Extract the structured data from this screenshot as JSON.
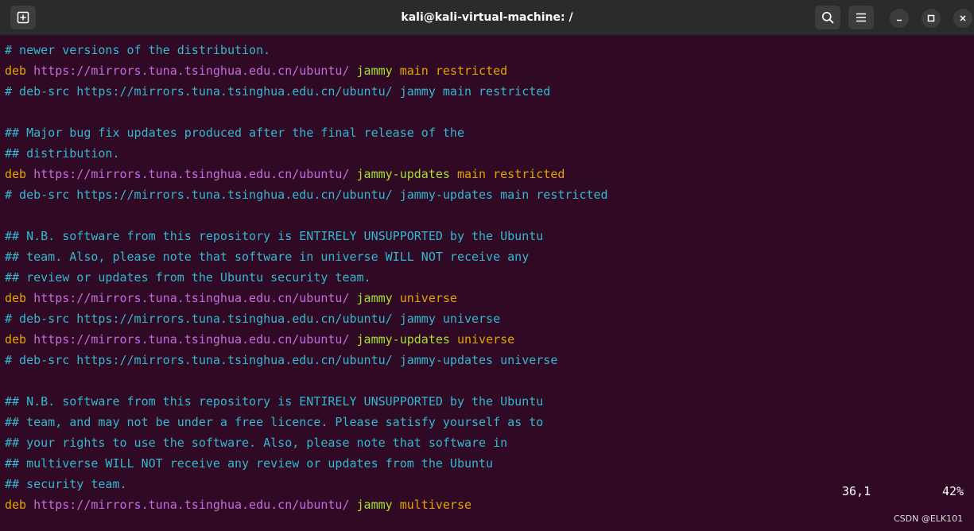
{
  "window": {
    "title": "kali@kali-virtual-machine: /",
    "colors": {
      "background": "#300a24",
      "titlebar": "#2b2b2b",
      "comment": "#34b7d0",
      "keyword": "#e4a400",
      "url": "#c56be0",
      "suite": "#a6e22e"
    },
    "icons": {
      "new_tab": "new-tab-icon",
      "search": "search-icon",
      "menu": "hamburger-menu-icon",
      "minimize": "minimize-icon",
      "maximize": "maximize-icon",
      "close": "close-icon"
    }
  },
  "lines": [
    {
      "type": "comment",
      "text": "# newer versions of the distribution."
    },
    {
      "type": "deb",
      "kw": "deb",
      "url": "https://mirrors.tuna.tsinghua.edu.cn/ubuntu/",
      "suite": "jammy",
      "components": "main restricted"
    },
    {
      "type": "comment",
      "text": "# deb-src https://mirrors.tuna.tsinghua.edu.cn/ubuntu/ jammy main restricted"
    },
    {
      "type": "blank",
      "text": ""
    },
    {
      "type": "comment",
      "text": "## Major bug fix updates produced after the final release of the"
    },
    {
      "type": "comment",
      "text": "## distribution."
    },
    {
      "type": "deb",
      "kw": "deb",
      "url": "https://mirrors.tuna.tsinghua.edu.cn/ubuntu/",
      "suite": "jammy-updates",
      "components": "main restricted"
    },
    {
      "type": "comment",
      "text": "# deb-src https://mirrors.tuna.tsinghua.edu.cn/ubuntu/ jammy-updates main restricted"
    },
    {
      "type": "blank",
      "text": ""
    },
    {
      "type": "comment",
      "text": "## N.B. software from this repository is ENTIRELY UNSUPPORTED by the Ubuntu"
    },
    {
      "type": "comment",
      "text": "## team. Also, please note that software in universe WILL NOT receive any"
    },
    {
      "type": "comment",
      "text": "## review or updates from the Ubuntu security team."
    },
    {
      "type": "deb",
      "kw": "deb",
      "url": "https://mirrors.tuna.tsinghua.edu.cn/ubuntu/",
      "suite": "jammy",
      "components": "universe"
    },
    {
      "type": "comment",
      "text": "# deb-src https://mirrors.tuna.tsinghua.edu.cn/ubuntu/ jammy universe"
    },
    {
      "type": "deb",
      "kw": "deb",
      "url": "https://mirrors.tuna.tsinghua.edu.cn/ubuntu/",
      "suite": "jammy-updates",
      "components": "universe"
    },
    {
      "type": "comment",
      "text": "# deb-src https://mirrors.tuna.tsinghua.edu.cn/ubuntu/ jammy-updates universe"
    },
    {
      "type": "blank",
      "text": ""
    },
    {
      "type": "comment",
      "text": "## N.B. software from this repository is ENTIRELY UNSUPPORTED by the Ubuntu"
    },
    {
      "type": "comment",
      "text": "## team, and may not be under a free licence. Please satisfy yourself as to"
    },
    {
      "type": "comment",
      "text": "## your rights to use the software. Also, please note that software in"
    },
    {
      "type": "comment",
      "text": "## multiverse WILL NOT receive any review or updates from the Ubuntu"
    },
    {
      "type": "comment",
      "text": "## security team."
    },
    {
      "type": "deb",
      "kw": "deb",
      "url": "https://mirrors.tuna.tsinghua.edu.cn/ubuntu/",
      "suite": "jammy",
      "components": "multiverse"
    }
  ],
  "status": {
    "position": "36,1",
    "percent": "42%"
  },
  "watermark": "CSDN @ELK101"
}
